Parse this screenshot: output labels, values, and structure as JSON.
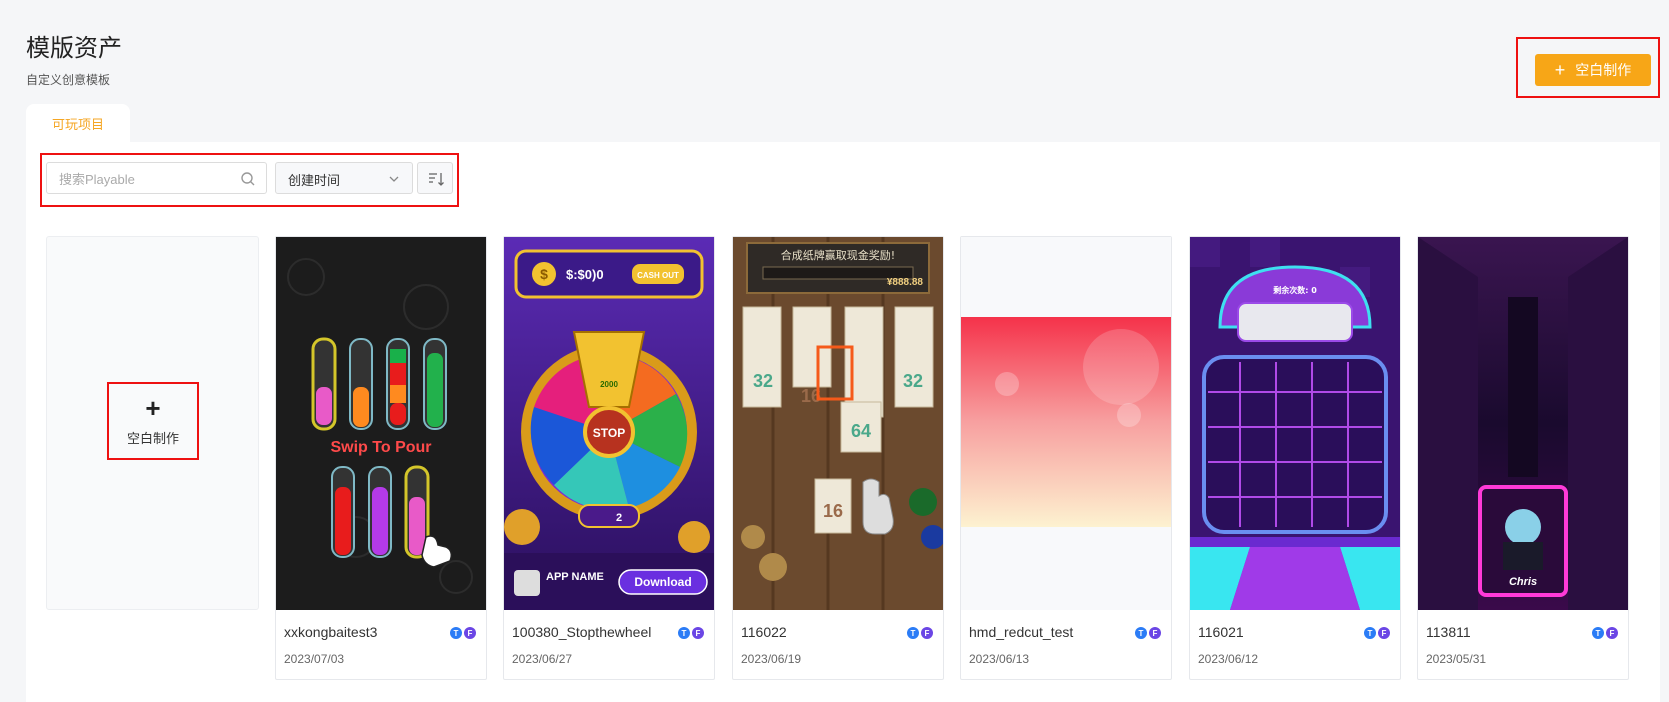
{
  "header": {
    "title": "模版资产",
    "subtitle": "自定义创意模板",
    "create_button": {
      "icon": "plus-icon",
      "label": "空白制作"
    }
  },
  "tabs": [
    {
      "label": "可玩项目",
      "active": true
    }
  ],
  "toolbar": {
    "search": {
      "placeholder": "搜索Playable",
      "value": ""
    },
    "sort_select": {
      "value": "创建时间"
    }
  },
  "blank_card": {
    "icon": "plus-icon",
    "label": "空白制作"
  },
  "cards": [
    {
      "name": "xxkongbaitest3",
      "date": "2023/07/03",
      "badges": [
        "T",
        "F"
      ],
      "thumb_text": "Swip To Pour"
    },
    {
      "name": "100380_Stopthewheel",
      "date": "2023/06/27",
      "badges": [
        "T",
        "F"
      ],
      "thumb_text": "STOP",
      "thumb_extra": [
        "$:$0)0",
        "CASH OUT",
        "Download",
        "APP NAME",
        "2000"
      ]
    },
    {
      "name": "116022",
      "date": "2023/06/19",
      "badges": [
        "T",
        "F"
      ],
      "thumb_text": "合成纸牌赢取现金奖励!",
      "thumb_extra": [
        "¥888.88",
        "32",
        "16",
        "64"
      ]
    },
    {
      "name": "hmd_redcut_test",
      "date": "2023/06/13",
      "badges": [
        "T",
        "F"
      ],
      "thumb_text": ""
    },
    {
      "name": "116021",
      "date": "2023/06/12",
      "badges": [
        "T",
        "F"
      ],
      "thumb_text": "剩余次数: 0"
    },
    {
      "name": "113811",
      "date": "2023/05/31",
      "badges": [
        "T",
        "F"
      ],
      "thumb_text": "Chris"
    }
  ],
  "colors": {
    "accent": "#f7a617",
    "tab_active": "#f5a623",
    "highlight_border": "#ee1111",
    "badge_t": "#2b7cf6",
    "badge_f": "#6b46e5"
  }
}
